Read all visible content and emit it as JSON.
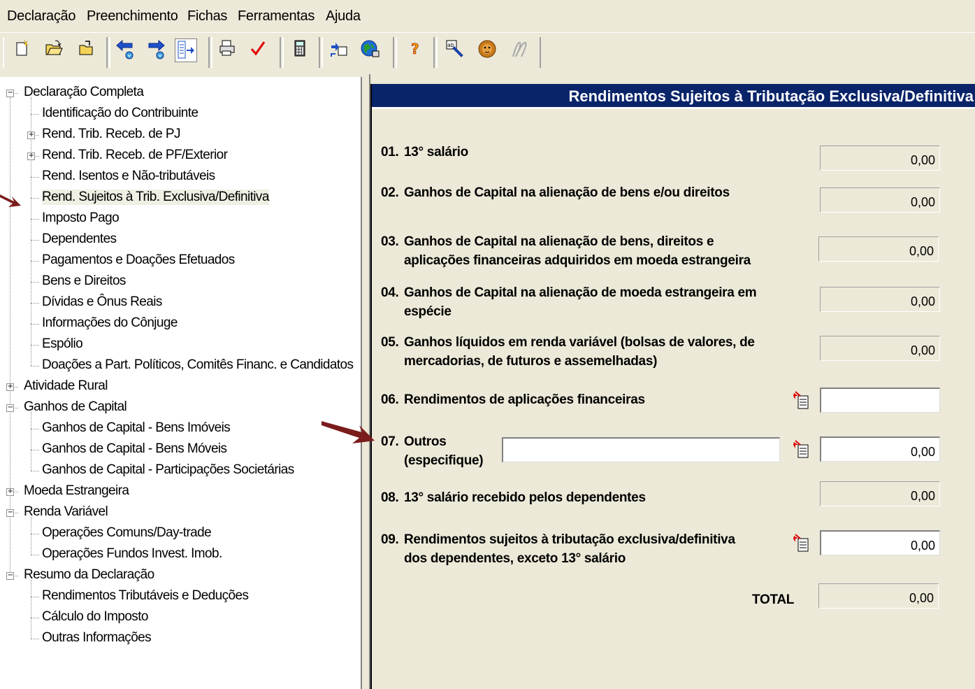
{
  "menu": [
    "Declaração",
    "Preenchimento",
    "Fichas",
    "Ferramentas",
    "Ajuda"
  ],
  "toolbar_icons": [
    "new-declaration-icon",
    "open-folder-icon",
    "open-file-icon",
    "back-arrow-icon",
    "forward-arrow-icon",
    "navigator-icon",
    "print-icon",
    "verify-check-icon",
    "calculator-icon",
    "transmit-icon",
    "internet-icon",
    "help-icon",
    "pendencies-icon",
    "lion-icon",
    "signature-icon"
  ],
  "tree": [
    {
      "label": "Declaração Completa",
      "level": 0,
      "toggle": "minus"
    },
    {
      "label": "Identificação do Contribuinte",
      "level": 1
    },
    {
      "label": "Rend. Trib. Receb. de PJ",
      "level": 1,
      "toggle": "plus"
    },
    {
      "label": "Rend. Trib. Receb. de PF/Exterior",
      "level": 1,
      "toggle": "plus"
    },
    {
      "label": "Rend. Isentos e Não-tributáveis",
      "level": 1
    },
    {
      "label": "Rend. Sujeitos à Trib. Exclusiva/Definitiva",
      "level": 1,
      "selected": true
    },
    {
      "label": "Imposto Pago",
      "level": 1
    },
    {
      "label": "Dependentes",
      "level": 1
    },
    {
      "label": "Pagamentos e Doações Efetuados",
      "level": 1
    },
    {
      "label": "Bens e Direitos",
      "level": 1
    },
    {
      "label": "Dívidas e Ônus Reais",
      "level": 1
    },
    {
      "label": "Informações do Cônjuge",
      "level": 1
    },
    {
      "label": "Espólio",
      "level": 1
    },
    {
      "label": "Doações a Part. Políticos, Comitês Financ. e Candidatos",
      "level": 1
    },
    {
      "label": "Atividade Rural",
      "level": 0,
      "toggle": "plus"
    },
    {
      "label": "Ganhos de Capital",
      "level": 0,
      "toggle": "minus"
    },
    {
      "label": "Ganhos de Capital - Bens Imóveis",
      "level": 1
    },
    {
      "label": "Ganhos de Capital - Bens Móveis",
      "level": 1
    },
    {
      "label": "Ganhos de Capital - Participações Societárias",
      "level": 1
    },
    {
      "label": "Moeda Estrangeira",
      "level": 0,
      "toggle": "plus"
    },
    {
      "label": "Renda Variável",
      "level": 0,
      "toggle": "minus"
    },
    {
      "label": "Operações Comuns/Day-trade",
      "level": 1
    },
    {
      "label": "Operações Fundos Invest. Imob.",
      "level": 1
    },
    {
      "label": "Resumo da Declaração",
      "level": 0,
      "toggle": "minus"
    },
    {
      "label": "Rendimentos Tributáveis e Deduções",
      "level": 1
    },
    {
      "label": "Cálculo do Imposto",
      "level": 1
    },
    {
      "label": "Outras Informações",
      "level": 1
    }
  ],
  "form": {
    "title": "Rendimentos Sujeitos à Tributação Exclusiva/Definitiva",
    "fields": [
      {
        "num": "01.",
        "lines": [
          "13° salário"
        ],
        "value": "0,00",
        "editable": false
      },
      {
        "num": "02.",
        "lines": [
          "Ganhos de Capital na alienação de bens e/ou direitos"
        ],
        "value": "0,00",
        "editable": false
      },
      {
        "num": "03.",
        "lines": [
          "Ganhos de Capital na alienação de bens, direitos e",
          "aplicações financeiras adquiridos em moeda estrangeira"
        ],
        "value": "0,00",
        "editable": false
      },
      {
        "num": "04.",
        "lines": [
          "Ganhos de Capital na alienação de moeda estrangeira em",
          "espécie"
        ],
        "value": "0,00",
        "editable": false
      },
      {
        "num": "05.",
        "lines": [
          "Ganhos líquidos em renda variável (bolsas de valores, de",
          "mercadorias, de futuros e assemelhadas)"
        ],
        "value": "0,00",
        "editable": false
      },
      {
        "num": "06.",
        "lines": [
          "Rendimentos de aplicações financeiras"
        ],
        "value": "",
        "editable": true
      },
      {
        "num": "07.",
        "lines": [
          "Outros",
          "(especifique)"
        ],
        "value": "0,00",
        "editable": true,
        "spec": ""
      },
      {
        "num": "08.",
        "lines": [
          "13° salário recebido pelos dependentes"
        ],
        "value": "0,00",
        "editable": false
      },
      {
        "num": "09.",
        "lines": [
          "Rendimentos sujeitos à tributação exclusiva/definitiva",
          "dos dependentes, exceto 13° salário"
        ],
        "value": "0,00",
        "editable": true
      }
    ],
    "total_label": "TOTAL",
    "total_value": "0,00"
  },
  "colors": {
    "header_bg": "#0a246a",
    "arrow": "#7b1c1c",
    "window": "#ece9d8"
  }
}
